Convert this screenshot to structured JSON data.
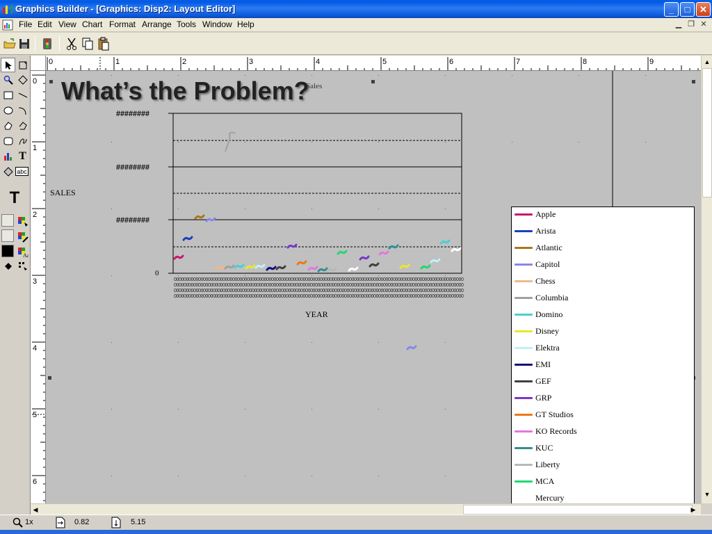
{
  "window": {
    "title": "Graphics Builder - [Graphics: Disp2: Layout Editor]",
    "min_glyph": "_",
    "max_glyph": "□",
    "close_glyph": "✕"
  },
  "menu": {
    "items": [
      "File",
      "Edit",
      "View",
      "Chart",
      "Format",
      "Arrange",
      "Tools",
      "Window",
      "Help"
    ]
  },
  "toolbar": {
    "buttons": [
      "open-icon",
      "save-icon",
      "run-icon",
      "cut-icon",
      "copy-icon",
      "paste-icon"
    ]
  },
  "palette": {
    "text_tool_glyph": "T",
    "text_label_glyph": "abc",
    "big_text_glyph": "T"
  },
  "ruler": {
    "h_labels": [
      "0",
      "1",
      "2",
      "3",
      "4",
      "5",
      "6",
      "7",
      "8",
      "9"
    ],
    "v_labels": [
      "0",
      "1",
      "2",
      "3",
      "4",
      "5",
      "6"
    ]
  },
  "canvas": {
    "heading": "What’s the Problem?",
    "chart_title": "Sales",
    "ylabel": "SALES",
    "xlabel": "YEAR",
    "y_ticks": [
      "########",
      "########",
      "########",
      "0"
    ]
  },
  "chart_data": {
    "type": "line",
    "title": "Sales",
    "xlabel": "YEAR",
    "ylabel": "SALES",
    "y_tick_labels": [
      "0",
      "########",
      "########",
      "########"
    ],
    "grid": true,
    "legend": "right",
    "series": [
      {
        "name": "Apple",
        "color": "#c8186c"
      },
      {
        "name": "Arista",
        "color": "#1840b8"
      },
      {
        "name": "Atlantic",
        "color": "#a87818"
      },
      {
        "name": "Capitol",
        "color": "#8888e8"
      },
      {
        "name": "Chess",
        "color": "#f0b888"
      },
      {
        "name": "Columbia",
        "color": "#a0a0a0"
      },
      {
        "name": "Domino",
        "color": "#48d0d0"
      },
      {
        "name": "Disney",
        "color": "#e8e830"
      },
      {
        "name": "Elektra",
        "color": "#c0f0f8"
      },
      {
        "name": "EMI",
        "color": "#101080"
      },
      {
        "name": "GEF",
        "color": "#404040"
      },
      {
        "name": "GRP",
        "color": "#7838c8"
      },
      {
        "name": "GT Studios",
        "color": "#f07818"
      },
      {
        "name": "KO Records",
        "color": "#e078e0"
      },
      {
        "name": "KUC",
        "color": "#309090"
      },
      {
        "name": "Liberty",
        "color": "#b8b8b8"
      },
      {
        "name": "MCA",
        "color": "#20d870"
      },
      {
        "name": "Mercury",
        "color": "#ffffff"
      }
    ]
  },
  "status": {
    "zoom": "1x",
    "x_value": "0.82",
    "y_value": "5.15"
  }
}
